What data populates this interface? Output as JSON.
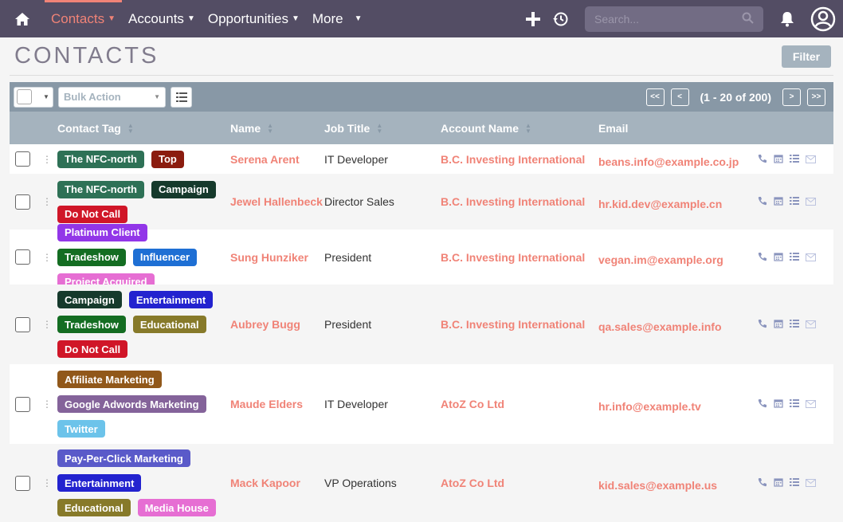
{
  "nav": {
    "items": [
      {
        "label": "Contacts",
        "active": true
      },
      {
        "label": "Accounts",
        "active": false
      },
      {
        "label": "Opportunities",
        "active": false
      },
      {
        "label": "More",
        "active": false
      }
    ],
    "search_placeholder": "Search..."
  },
  "page": {
    "title": "CONTACTS",
    "filter_label": "Filter"
  },
  "toolbar": {
    "bulk_action": "Bulk Action",
    "pager_first": "<<",
    "pager_prev": "<",
    "pager_count": "(1 - 20 of 200)",
    "pager_next": ">",
    "pager_last": ">>"
  },
  "columns": {
    "tag": "Contact Tag",
    "name": "Name",
    "job": "Job Title",
    "account": "Account Name",
    "email": "Email"
  },
  "colors": {
    "topbar": "#534d64",
    "accent": "#f08377",
    "toolbar": "#8898a6",
    "header": "#a5b3be"
  },
  "rows": [
    {
      "tags": [
        {
          "t": "The NFC-north",
          "c": "#2e7156"
        },
        {
          "t": "Top",
          "c": "#8b1c0f"
        }
      ],
      "name": "Serena Arent",
      "job": "IT Developer",
      "account": "B.C. Investing International",
      "email": "beans.info@example.co.jp"
    },
    {
      "tags": [
        {
          "t": "The NFC-north",
          "c": "#2e7156"
        },
        {
          "t": "Campaign",
          "c": "#163a2c"
        },
        {
          "t": "Do Not Call",
          "c": "#d01628"
        }
      ],
      "name": "Jewel Hallenbeck",
      "job": "Director Sales",
      "account": "B.C. Investing International",
      "email": "hr.kid.dev@example.cn"
    },
    {
      "tags": [
        {
          "t": "Platinum Client",
          "c": "#9236e8"
        },
        {
          "t": "Tradeshow",
          "c": "#146d22"
        },
        {
          "t": "Influencer",
          "c": "#1e6fd4"
        },
        {
          "t": "Project Acquired",
          "c": "#e66ed3"
        }
      ],
      "name": "Sung Hunziker",
      "job": "President",
      "account": "B.C. Investing International",
      "email": "vegan.im@example.org"
    },
    {
      "tags": [
        {
          "t": "Campaign",
          "c": "#163a2c"
        },
        {
          "t": "Entertainment",
          "c": "#2323cf"
        },
        {
          "t": "Tradeshow",
          "c": "#146d22"
        },
        {
          "t": "Educational",
          "c": "#877a2a"
        },
        {
          "t": "Do Not Call",
          "c": "#d01628"
        }
      ],
      "name": "Aubrey Bugg",
      "job": "President",
      "account": "B.C. Investing International",
      "email": "qa.sales@example.info"
    },
    {
      "tags": [
        {
          "t": "Affiliate Marketing",
          "c": "#91581a"
        },
        {
          "t": "Google Adwords Marketing",
          "c": "#84639a"
        },
        {
          "t": "Twitter",
          "c": "#6cc3ea"
        }
      ],
      "name": "Maude Elders",
      "job": "IT Developer",
      "account": "AtoZ Co Ltd",
      "email": "hr.info@example.tv"
    },
    {
      "tags": [
        {
          "t": "Pay-Per-Click Marketing",
          "c": "#5a5ac9"
        },
        {
          "t": "Entertainment",
          "c": "#2323cf"
        },
        {
          "t": "Educational",
          "c": "#877a2a"
        },
        {
          "t": "Media House",
          "c": "#e66ed3"
        }
      ],
      "name": "Mack Kapoor",
      "job": "VP Operations",
      "account": "AtoZ Co Ltd",
      "email": "kid.sales@example.us"
    }
  ]
}
